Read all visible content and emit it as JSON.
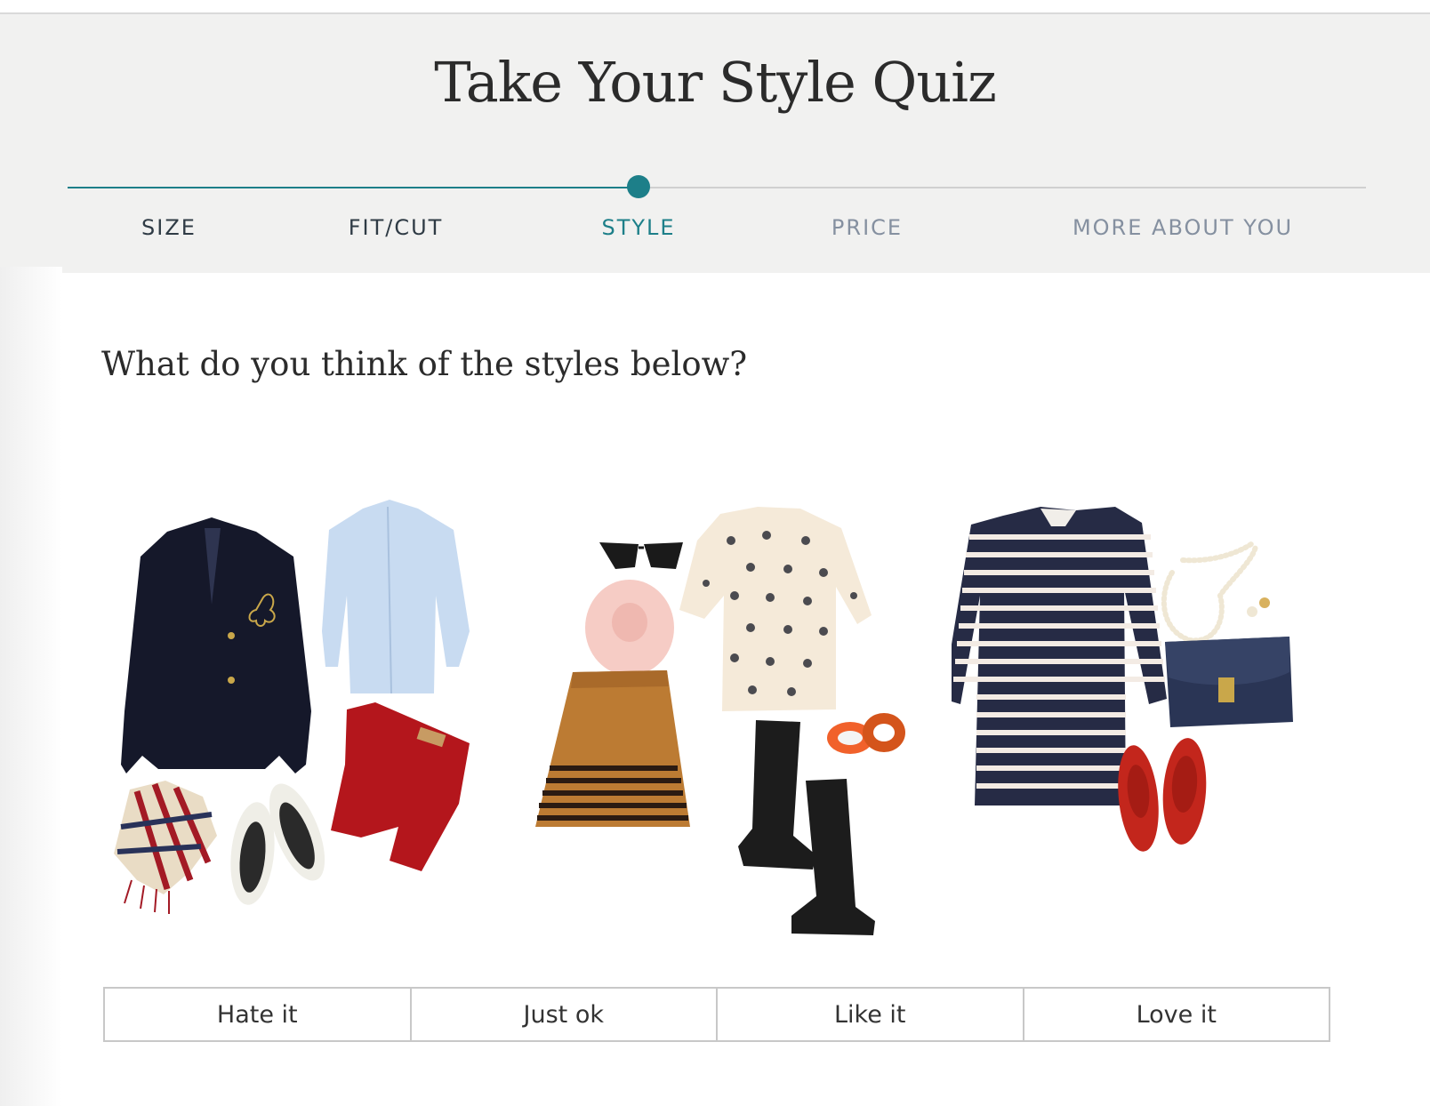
{
  "page": {
    "title": "Take Your Style Quiz"
  },
  "progress": {
    "steps": [
      {
        "label": "SIZE",
        "state": "done"
      },
      {
        "label": "FIT/CUT",
        "state": "done"
      },
      {
        "label": "STYLE",
        "state": "active"
      },
      {
        "label": "PRICE",
        "state": "future"
      },
      {
        "label": "MORE ABOUT YOU",
        "state": "future"
      }
    ],
    "current_step": 3,
    "total_steps": 5,
    "accent_color": "#1d7f89"
  },
  "question": {
    "text": "What do you think of the styles below?"
  },
  "outfits": [
    {
      "name": "outfit-preppy",
      "items": [
        "navy-blazer",
        "light-blue-shirt",
        "red-jeans",
        "plaid-scarf",
        "cap-toe-flats"
      ]
    },
    {
      "name": "outfit-polka-dot",
      "items": [
        "sunglasses",
        "pink-scarf",
        "polka-dot-top",
        "striped-pleated-skirt",
        "black-riding-boots",
        "orange-bangles"
      ]
    },
    {
      "name": "outfit-stripes",
      "items": [
        "striped-shift-dress",
        "pearl-necklace",
        "pearl-earrings",
        "navy-clutch",
        "red-ballet-flats"
      ]
    }
  ],
  "ratings": {
    "options": [
      "Hate it",
      "Just ok",
      "Like it",
      "Love it"
    ]
  }
}
